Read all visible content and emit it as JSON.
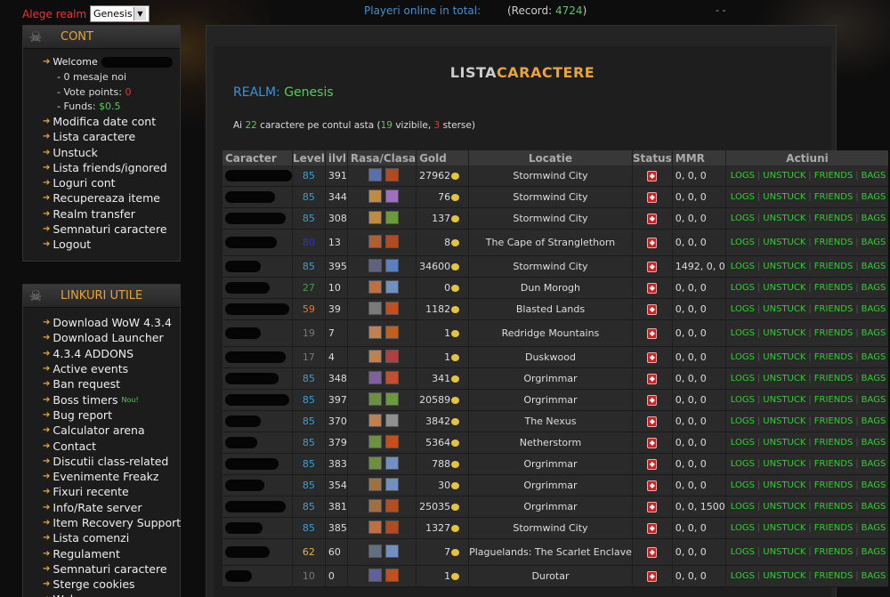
{
  "topbar": {
    "realm_label": "Alege realm",
    "realm_value": "Genesis",
    "online_label": "Playeri online in total:",
    "record_label": "(Record:",
    "record_value": "4724",
    "record_close": ")",
    "dashes": "- -"
  },
  "cont": {
    "title": "CONT",
    "welcome": "Welcome",
    "messages": "- 0 mesaje noi",
    "vote_label": "- Vote points:",
    "vote_value": "0",
    "funds_label": "- Funds:",
    "funds_value": "$0.5",
    "items": [
      "Modifica date cont",
      "Lista caractere",
      "Unstuck",
      "Lista friends/ignored",
      "Loguri cont",
      "Recupereaza iteme",
      "Realm transfer",
      "Semnaturi caractere",
      "Logout"
    ]
  },
  "links": {
    "title": "LINKURI UTILE",
    "new_badge": "Nou!",
    "items": [
      "Download WoW 4.3.4",
      "Download Launcher",
      "4.3.4 ADDONS",
      "Active events",
      "Ban request",
      "Boss timers",
      "Bug report",
      "Calculator arena",
      "Contact",
      "Discutii class-related",
      "Evenimente Freakz",
      "Fixuri recente",
      "Info/Rate server",
      "Item Recovery Support",
      "Lista comenzi",
      "Regulament",
      "Semnaturi caractere",
      "Sterge cookies",
      "Web..."
    ]
  },
  "main": {
    "title_a": "LISTA",
    "title_b": "CARACTERE",
    "realm_label": "REALM:",
    "realm_value": "Genesis",
    "sum_a": "Ai",
    "sum_total": "22",
    "sum_b": "caractere pe contul asta (",
    "sum_visible": "19",
    "sum_c": "vizibile,",
    "sum_deleted": "3",
    "sum_d": "sterse)"
  },
  "columns": [
    "Caracter",
    "Level",
    "ilvl",
    "Rasa/Clasa",
    "Gold",
    "Locatie",
    "Status",
    "MMR",
    "Actiuni"
  ],
  "actions": {
    "logs": "LOGS",
    "unstuck": "UNSTUCK",
    "friends": "FRIENDS",
    "bags": "BAGS",
    "sep": "|"
  },
  "colors": {
    "accent": "#e8a43a",
    "blue": "#3a93d4",
    "green": "#55cc55",
    "red": "#ee3333"
  },
  "rows": [
    {
      "level": "85",
      "lc": "lv85",
      "ilvl": "391",
      "gold": "27962",
      "loc": "Stormwind City",
      "mmr": "0, 0, 0",
      "r": "#5a6fb0",
      "c": "#b04a20"
    },
    {
      "level": "85",
      "lc": "lv85",
      "ilvl": "344",
      "gold": "76",
      "loc": "Stormwind City",
      "mmr": "0, 0, 0",
      "r": "#c08a40",
      "c": "#a070c0"
    },
    {
      "level": "85",
      "lc": "lv85",
      "ilvl": "308",
      "gold": "137",
      "loc": "Stormwind City",
      "mmr": "0, 0, 0",
      "r": "#c08a40",
      "c": "#6a9a40"
    },
    {
      "level": "80",
      "lc": "lvblue",
      "ilvl": "13",
      "gold": "8",
      "loc": "The Cape of Stranglethorn",
      "mmr": "0, 0, 0",
      "r": "#b06030",
      "c": "#b04a20"
    },
    {
      "level": "85",
      "lc": "lv85",
      "ilvl": "395",
      "gold": "34600",
      "loc": "Stormwind City",
      "mmr": "1492, 0, 0",
      "r": "#606080",
      "c": "#5a80c0"
    },
    {
      "level": "27",
      "lc": "lvgreen",
      "ilvl": "10",
      "gold": "0",
      "loc": "Dun Morogh",
      "mmr": "0, 0, 0",
      "r": "#c07040",
      "c": "#7090c0"
    },
    {
      "level": "59",
      "lc": "lvorange",
      "ilvl": "39",
      "gold": "1182",
      "loc": "Blasted Lands",
      "mmr": "0, 0, 0",
      "r": "#7a7a7a",
      "c": "#c05020"
    },
    {
      "level": "19",
      "lc": "lvgray",
      "ilvl": "7",
      "gold": "1",
      "loc": "Redridge Mountains",
      "mmr": "0, 0, 0",
      "r": "#c08050",
      "c": "#c06020"
    },
    {
      "level": "17",
      "lc": "lvgray",
      "ilvl": "4",
      "gold": "1",
      "loc": "Duskwood",
      "mmr": "0, 0, 0",
      "r": "#c08050",
      "c": "#b04040"
    },
    {
      "level": "85",
      "lc": "lv85",
      "ilvl": "348",
      "gold": "341",
      "loc": "Orgrimmar",
      "mmr": "0, 0, 0",
      "r": "#8060a0",
      "c": "#c05030"
    },
    {
      "level": "85",
      "lc": "lv85",
      "ilvl": "397",
      "gold": "20589",
      "loc": "Orgrimmar",
      "mmr": "0, 0, 0",
      "r": "#6a9040",
      "c": "#6a9a40"
    },
    {
      "level": "85",
      "lc": "lv85",
      "ilvl": "370",
      "gold": "3842",
      "loc": "The Nexus",
      "mmr": "0, 0, 0",
      "r": "#c08050",
      "c": "#909090"
    },
    {
      "level": "85",
      "lc": "lv85",
      "ilvl": "379",
      "gold": "5364",
      "loc": "Netherstorm",
      "mmr": "0, 0, 0",
      "r": "#6a9040",
      "c": "#c05020"
    },
    {
      "level": "85",
      "lc": "lv85",
      "ilvl": "383",
      "gold": "788",
      "loc": "Orgrimmar",
      "mmr": "0, 0, 0",
      "r": "#6a9040",
      "c": "#7090c0"
    },
    {
      "level": "85",
      "lc": "lv85",
      "ilvl": "354",
      "gold": "30",
      "loc": "Orgrimmar",
      "mmr": "0, 0, 0",
      "r": "#a07040",
      "c": "#7090c0"
    },
    {
      "level": "85",
      "lc": "lv85",
      "ilvl": "381",
      "gold": "25035",
      "loc": "Orgrimmar",
      "mmr": "0, 0, 1500",
      "r": "#a07040",
      "c": "#b05020"
    },
    {
      "level": "85",
      "lc": "lv85",
      "ilvl": "385",
      "gold": "1327",
      "loc": "Stormwind City",
      "mmr": "0, 0, 0",
      "r": "#c07040",
      "c": "#b04a20"
    },
    {
      "level": "62",
      "lc": "lvgold",
      "ilvl": "60",
      "gold": "7",
      "loc": "Plaguelands: The Scarlet Enclave",
      "mmr": "0, 0, 0",
      "r": "#607080",
      "c": "#7090c0"
    },
    {
      "level": "10",
      "lc": "lvgray",
      "ilvl": "0",
      "gold": "1",
      "loc": "Durotar",
      "mmr": "0, 0, 0",
      "r": "#6060a0",
      "c": "#c05020"
    }
  ]
}
